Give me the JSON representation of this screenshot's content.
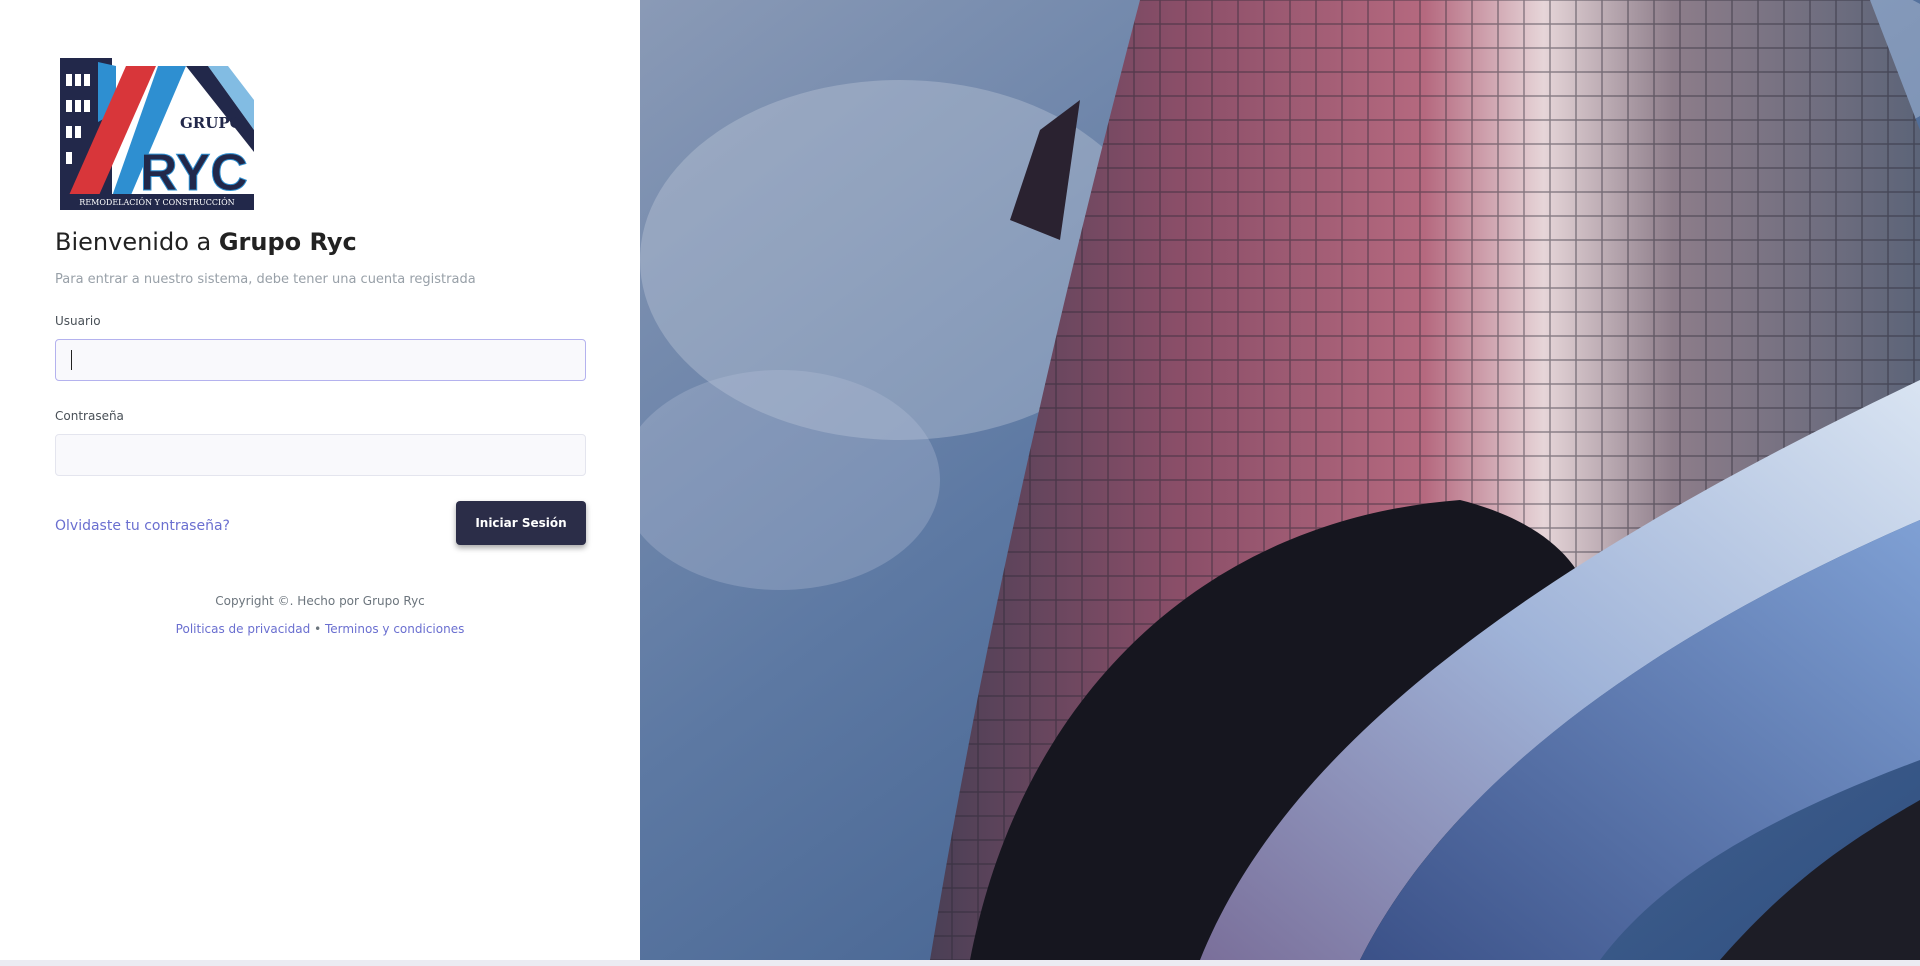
{
  "logo": {
    "top_text": "GRUPO",
    "main_text": "RYC",
    "tagline": "REMODELACIÓN Y CONSTRUCCIÓN"
  },
  "welcome": {
    "prefix": "Bienvenido a",
    "brand": "Grupo Ryc"
  },
  "subtitle": "Para entrar a nuestro sistema, debe tener una cuenta registrada",
  "form": {
    "username_label": "Usuario",
    "username_value": "",
    "password_label": "Contraseña",
    "password_value": "",
    "forgot_link": "Olvidaste tu contraseña?",
    "submit_label": "Iniciar Sesión"
  },
  "footer": {
    "copyright": "Copyright ©. Hecho por Grupo Ryc",
    "privacy": "Politicas de privacidad",
    "separator": "•",
    "terms": "Terminos y condiciones"
  },
  "colors": {
    "brand_dark": "#2b2d48",
    "link": "#6a6fd0",
    "logo_red": "#d8363a",
    "logo_blue": "#2e8fd1",
    "logo_navy": "#22284a"
  },
  "background_image": "building-photo"
}
